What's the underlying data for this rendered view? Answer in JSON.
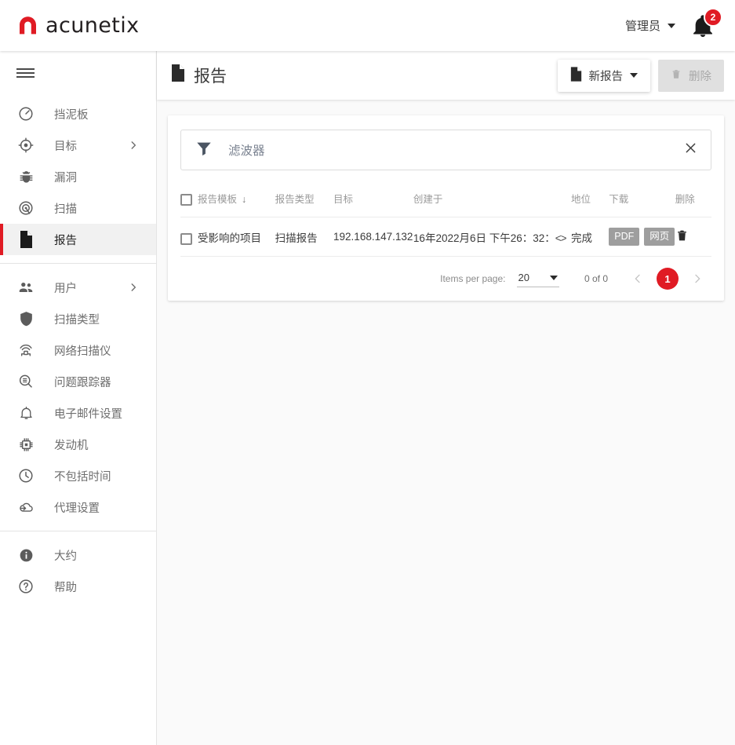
{
  "brand": {
    "name": "acunetix",
    "logo_icon": "acunetix-logo-icon",
    "accent": "#e01b24"
  },
  "topbar": {
    "user_label": "管理员",
    "user_caret_icon": "caret-down-icon",
    "bell_icon": "bell-icon",
    "notification_count": "2"
  },
  "sidebar": {
    "menu_icon": "hamburger-menu-icon",
    "groups": [
      {
        "items": [
          {
            "label": "挡泥板",
            "icon": "gauge-icon",
            "chevron": false,
            "active": false
          },
          {
            "label": "目标",
            "icon": "target-icon",
            "chevron": true,
            "active": false
          },
          {
            "label": "漏洞",
            "icon": "bug-icon",
            "chevron": false,
            "active": false
          },
          {
            "label": "扫描",
            "icon": "radar-icon",
            "chevron": false,
            "active": false
          },
          {
            "label": "报告",
            "icon": "document-icon",
            "chevron": false,
            "active": true
          }
        ]
      },
      {
        "items": [
          {
            "label": "用户",
            "icon": "users-icon",
            "chevron": true,
            "active": false
          },
          {
            "label": "扫描类型",
            "icon": "shield-icon",
            "chevron": false,
            "active": false
          },
          {
            "label": "网络扫描仪",
            "icon": "network-scanner-icon",
            "chevron": false,
            "active": false
          },
          {
            "label": "问题跟踪器",
            "icon": "issue-tracker-icon",
            "chevron": false,
            "active": false
          },
          {
            "label": "电子邮件设置",
            "icon": "bell-outline-icon",
            "chevron": false,
            "active": false
          },
          {
            "label": "发动机",
            "icon": "cpu-chip-icon",
            "chevron": false,
            "active": false
          },
          {
            "label": "不包括时间",
            "icon": "clock-icon",
            "chevron": false,
            "active": false
          },
          {
            "label": "代理设置",
            "icon": "cloud-agent-icon",
            "chevron": false,
            "active": false
          }
        ]
      },
      {
        "items": [
          {
            "label": "大约",
            "icon": "info-icon",
            "chevron": false,
            "active": false
          },
          {
            "label": "帮助",
            "icon": "help-icon",
            "chevron": false,
            "active": false
          }
        ]
      }
    ]
  },
  "page": {
    "title": "报告",
    "title_icon": "document-icon",
    "new_report_label": "新报告",
    "new_report_icon": "document-icon",
    "new_report_caret_icon": "caret-down-icon",
    "delete_label": "删除",
    "delete_icon": "trash-icon"
  },
  "filter": {
    "icon": "funnel-icon",
    "placeholder": "滤波器",
    "value": "",
    "clear_icon": "close-icon"
  },
  "table": {
    "select_all_checked": false,
    "sort_icon": "arrow-down-icon",
    "columns": [
      {
        "key": "template",
        "label": "报告模板",
        "sorted": true
      },
      {
        "key": "type",
        "label": "报告类型",
        "sorted": false
      },
      {
        "key": "target",
        "label": "目标",
        "sorted": false
      },
      {
        "key": "created",
        "label": "创建于",
        "sorted": false
      },
      {
        "key": "status",
        "label": "地位",
        "sorted": false
      },
      {
        "key": "download",
        "label": "下载",
        "sorted": false
      },
      {
        "key": "delete",
        "label": "删除",
        "sorted": false
      }
    ],
    "rows": [
      {
        "checked": false,
        "template": "受影响的项目",
        "type": "扫描报告",
        "target": "192.168.147.132",
        "created": "16年2022月6日 下午26：32：",
        "created_truncated_icon": "ellipsis-icon",
        "status": "完成",
        "downloads": [
          {
            "label": "PDF",
            "name": "download-pdf-button"
          },
          {
            "label": "网页",
            "name": "download-html-button"
          }
        ],
        "delete_icon": "trash-icon"
      }
    ]
  },
  "paginator": {
    "items_per_page_label": "Items per page:",
    "items_per_page_value": "20",
    "select_caret_icon": "caret-down-icon",
    "range_label": "0 of 0",
    "prev_icon": "chevron-left-icon",
    "next_icon": "chevron-right-icon",
    "page_marker": "1"
  }
}
